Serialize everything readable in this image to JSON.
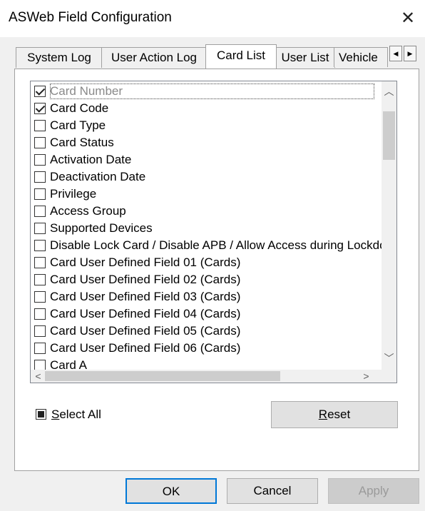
{
  "window": {
    "title": "ASWeb Field Configuration",
    "close_glyph": "✕"
  },
  "tabs": [
    {
      "label": "System Log",
      "active": false
    },
    {
      "label": "User Action Log",
      "active": false
    },
    {
      "label": "Card List",
      "active": true
    },
    {
      "label": "User List",
      "active": false
    },
    {
      "label": "Vehicle",
      "active": false
    }
  ],
  "tab_scroll": {
    "left_icon": "◀",
    "right_icon": "▶"
  },
  "fields": [
    {
      "label": "Card Number",
      "checked": true,
      "disabled": true,
      "focused": true
    },
    {
      "label": "Card Code",
      "checked": true
    },
    {
      "label": "Card Type",
      "checked": false
    },
    {
      "label": "Card Status",
      "checked": false
    },
    {
      "label": "Activation Date",
      "checked": false
    },
    {
      "label": "Deactivation Date",
      "checked": false
    },
    {
      "label": "Privilege",
      "checked": false
    },
    {
      "label": "Access Group",
      "checked": false
    },
    {
      "label": "Supported Devices",
      "checked": false
    },
    {
      "label": "Disable Lock Card / Disable APB / Allow Access during Lockdown",
      "checked": false
    },
    {
      "label": "Card User Defined Field 01 (Cards)",
      "checked": false
    },
    {
      "label": "Card User Defined Field 02 (Cards)",
      "checked": false
    },
    {
      "label": "Card User Defined Field 03 (Cards)",
      "checked": false
    },
    {
      "label": "Card User Defined Field 04 (Cards)",
      "checked": false
    },
    {
      "label": "Card User Defined Field 05 (Cards)",
      "checked": false
    },
    {
      "label": "Card User Defined Field 06 (Cards)",
      "checked": false
    },
    {
      "label": "Card A",
      "checked": false
    }
  ],
  "scrollbar": {
    "up": "︿",
    "down": "﹀",
    "left": "<",
    "right": ">"
  },
  "select_all": {
    "label_underlined": "S",
    "label_rest": "elect All",
    "state": "indeterminate"
  },
  "buttons": {
    "reset_underlined": "R",
    "reset_rest": "eset",
    "ok": "OK",
    "cancel": "Cancel",
    "apply": "Apply"
  },
  "colors": {
    "accent": "#0078d7",
    "window_bg": "#f0f0f0",
    "panel_bg": "#ffffff",
    "disabled_text": "#8a8a8a"
  }
}
